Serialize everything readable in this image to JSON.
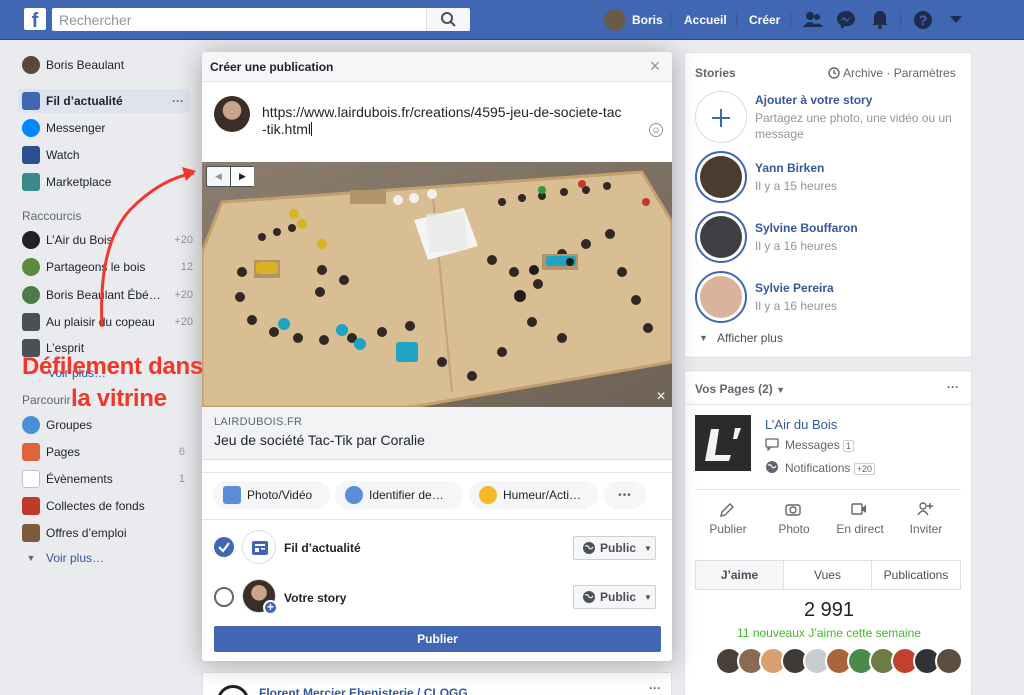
{
  "topbar": {
    "search_placeholder": "Rechercher",
    "user_name": "Boris",
    "nav_home": "Accueil",
    "nav_create": "Créer",
    "brand_color": "#4267b2"
  },
  "left": {
    "profile_name": "Boris Beaulant",
    "main_items": [
      {
        "label": "Fil d’actualité",
        "icon": "newsfeed-icon",
        "more": "···"
      },
      {
        "label": "Messenger",
        "icon": "messenger-icon"
      },
      {
        "label": "Watch",
        "icon": "watch-icon"
      },
      {
        "label": "Marketplace",
        "icon": "marketplace-icon"
      }
    ],
    "shortcuts_heading": "Raccourcis",
    "shortcuts": [
      {
        "label": "L’Air du Bois",
        "count": "+20"
      },
      {
        "label": "Partageons le bois",
        "count": "12"
      },
      {
        "label": "Boris Beaulant Ébé…",
        "count": "+20"
      },
      {
        "label": "Au plaisir du copeau",
        "count": "+20"
      },
      {
        "label": "L’esprit",
        "count": ""
      }
    ],
    "explore_heading": "Parcourir",
    "explore": [
      {
        "label": "Groupes",
        "count": ""
      },
      {
        "label": "Pages",
        "count": "6"
      },
      {
        "label": "Évènements",
        "count": "1"
      },
      {
        "label": "Collectes de fonds",
        "count": ""
      },
      {
        "label": "Offres d’emploi",
        "count": ""
      }
    ],
    "see_more": "Voir plus…",
    "hidden_item": "Voir plus…"
  },
  "modal": {
    "title": "Créer une publication",
    "composer_text": "https://www.lairdubois.fr/creations/4595-jeu-de-societe-tac-tik.html",
    "link_domain": "LAIRDUBOIS.FR",
    "link_title": "Jeu de société Tac-Tik par Coralie",
    "actions": [
      {
        "label": "Photo/Vidéo",
        "icon": "photo-icon"
      },
      {
        "label": "Identifier de…",
        "icon": "tag-people-icon"
      },
      {
        "label": "Humeur/Acti…",
        "icon": "feeling-icon"
      }
    ],
    "more_label": "•••",
    "share_targets": [
      {
        "label": "Fil d’actualité",
        "audience": "Public",
        "checked": true
      },
      {
        "label": "Votre story",
        "audience": "Public",
        "checked": false
      }
    ],
    "publish_label": "Publier"
  },
  "annotation": {
    "line1": "Défilement dans",
    "line2": "la vitrine",
    "color": "#f0372b"
  },
  "stories": {
    "title": "Stories",
    "archive": "Archive",
    "settings": "Paramètres",
    "add_title": "Ajouter à votre story",
    "add_desc": "Partagez une photo, une vidéo ou un message",
    "items": [
      {
        "name": "Yann Birken",
        "time": "Il y a 15 heures"
      },
      {
        "name": "Sylvine Bouffaron",
        "time": "Il y a 16 heures"
      },
      {
        "name": "Sylvie Pereira",
        "time": "Il y a 16 heures"
      }
    ],
    "show_more": "Afficher plus"
  },
  "pages": {
    "title": "Vos Pages (2)",
    "page_name": "L’Air du Bois",
    "messages_label": "Messages",
    "messages_count": "1",
    "notifications_label": "Notifications",
    "notifications_count": "+20",
    "actions": [
      "Publier",
      "Photo",
      "En direct",
      "Inviter"
    ],
    "tabs": [
      "J’aime",
      "Vues",
      "Publications"
    ],
    "likes_total": "2 991",
    "likes_new": "11 nouveaux J’aime cette semaine"
  },
  "feed": {
    "next_post_author": "Florent Mercier Ebenisterie / CLOGG"
  }
}
